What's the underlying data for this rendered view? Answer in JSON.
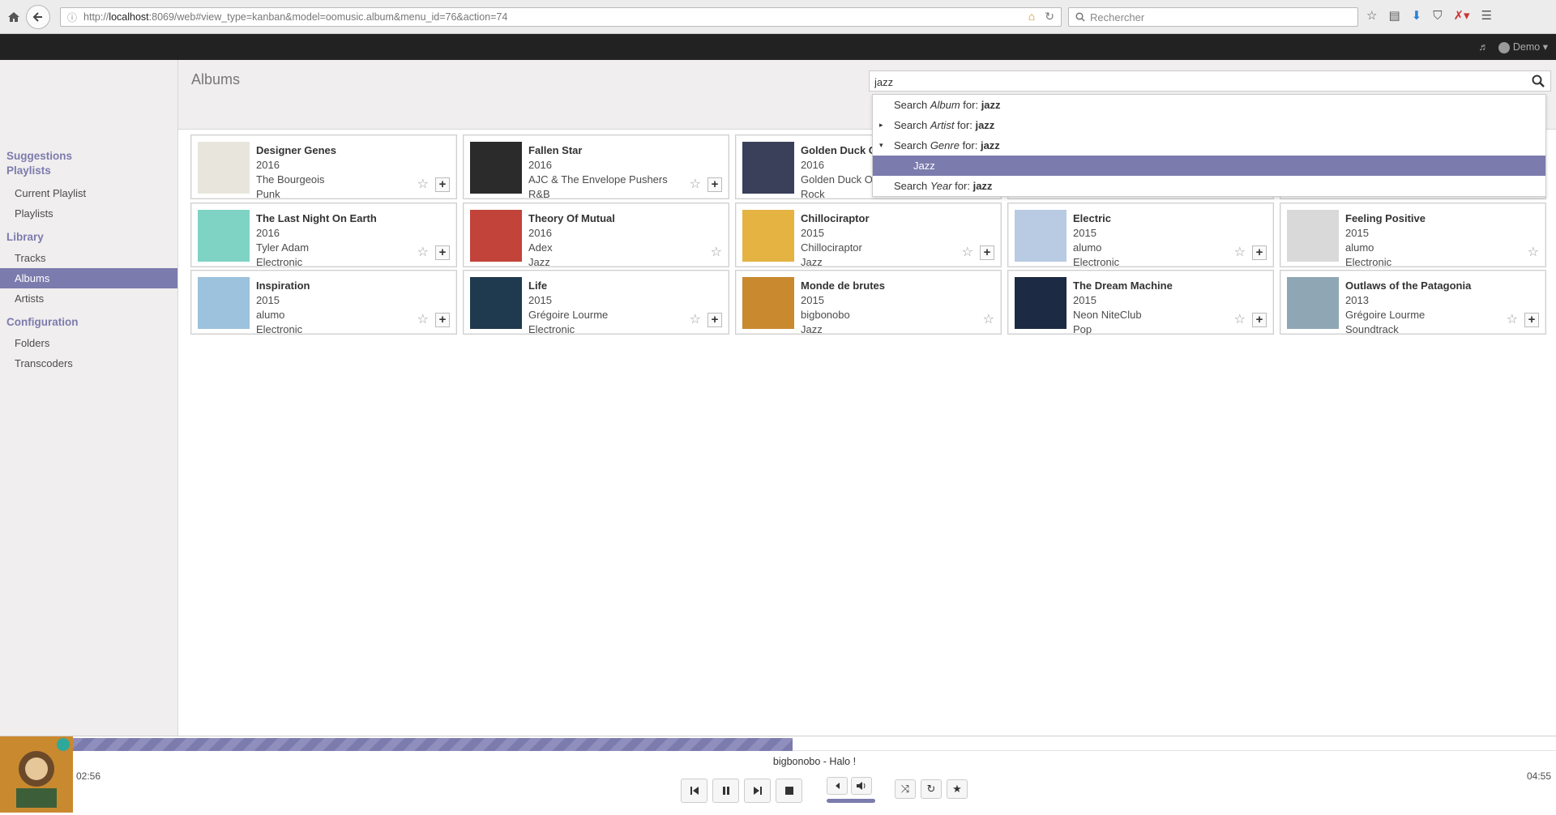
{
  "browser": {
    "url_prefix": "http://",
    "url_host": "localhost",
    "url_rest": ":8069/web#view_type=kanban&model=oomusic.album&menu_id=76&action=74",
    "search_placeholder": "Rechercher"
  },
  "topbar": {
    "user": "Demo"
  },
  "sidebar": {
    "sections": [
      {
        "title": "Suggestions",
        "items": []
      },
      {
        "title": "Playlists",
        "items": [
          "Current Playlist",
          "Playlists"
        ]
      },
      {
        "title": "Library",
        "items": [
          "Tracks",
          "Albums",
          "Artists"
        ]
      },
      {
        "title": "Configuration",
        "items": [
          "Folders",
          "Transcoders"
        ]
      }
    ],
    "active": "Albums"
  },
  "control_panel": {
    "title": "Albums",
    "search_value": "jazz"
  },
  "search_dropdown": {
    "items": [
      {
        "prefix": "Search ",
        "field": "Album",
        "mid": " for: ",
        "term": "jazz",
        "caret": ""
      },
      {
        "prefix": "Search ",
        "field": "Artist",
        "mid": " for: ",
        "term": "jazz",
        "caret": "▸"
      },
      {
        "prefix": "Search ",
        "field": "Genre",
        "mid": " for: ",
        "term": "jazz",
        "caret": "▾"
      },
      {
        "selected_option": "Jazz"
      },
      {
        "prefix": "Search ",
        "field": "Year",
        "mid": " for: ",
        "term": "jazz",
        "caret": ""
      }
    ]
  },
  "albums": [
    {
      "title": "Designer Genes",
      "year": "2016",
      "artist": "The Bourgeois",
      "genre": "Punk",
      "cover": "#e8e6dc",
      "add": true
    },
    {
      "title": "Fallen Star",
      "year": "2016",
      "artist": "AJC & The Envelope Pushers",
      "genre": "R&B",
      "cover": "#2b2b2b",
      "add": true
    },
    {
      "title": "Golden Duck Orchestra",
      "year": "2016",
      "artist": "Golden Duck Orchestra",
      "genre": "Rock",
      "cover": "#3a3f5a",
      "add": true
    },
    {
      "title": "",
      "year": "",
      "artist": "",
      "genre": "",
      "cover": "",
      "add": true
    },
    {
      "title": "",
      "year": "",
      "artist": "",
      "genre": "",
      "cover": "",
      "add": true
    },
    {
      "title": "The Last Night On Earth",
      "year": "2016",
      "artist": "Tyler Adam",
      "genre": "Electronic",
      "cover": "#7fd3c4",
      "add": true
    },
    {
      "title": "Theory Of Mutual",
      "year": "2016",
      "artist": "Adex",
      "genre": "Jazz",
      "cover": "#c2433a",
      "add": false
    },
    {
      "title": "Chillociraptor",
      "year": "2015",
      "artist": "Chillociraptor",
      "genre": "Jazz",
      "cover": "#e4b342",
      "add": true
    },
    {
      "title": "Electric",
      "year": "2015",
      "artist": "alumo",
      "genre": "Electronic",
      "cover": "#b9cbe3",
      "add": true
    },
    {
      "title": "Feeling Positive",
      "year": "2015",
      "artist": "alumo",
      "genre": "Electronic",
      "cover": "#d9d9d9",
      "add": false
    },
    {
      "title": "Inspiration",
      "year": "2015",
      "artist": "alumo",
      "genre": "Electronic",
      "cover": "#9cc2de",
      "add": true
    },
    {
      "title": "Life",
      "year": "2015",
      "artist": "Grégoire Lourme",
      "genre": "Electronic",
      "cover": "#1f3a4f",
      "add": true
    },
    {
      "title": "Monde de brutes",
      "year": "2015",
      "artist": "bigbonobo",
      "genre": "Jazz",
      "cover": "#c9892f",
      "add": false
    },
    {
      "title": "The Dream Machine",
      "year": "2015",
      "artist": "Neon NiteClub",
      "genre": "Pop",
      "cover": "#1d2a44",
      "add": true
    },
    {
      "title": "Outlaws of the Patagonia",
      "year": "2013",
      "artist": "Grégoire Lourme",
      "genre": "Soundtrack",
      "cover": "#8fa7b5",
      "add": true
    }
  ],
  "player": {
    "now_playing": "bigbonobo - Halo !",
    "time_current": "02:56",
    "time_total": "04:55",
    "progress_fraction": 0.485,
    "cover": "#c9892f"
  },
  "colors": {
    "accent": "#7c7bad",
    "topbar": "#222222"
  }
}
